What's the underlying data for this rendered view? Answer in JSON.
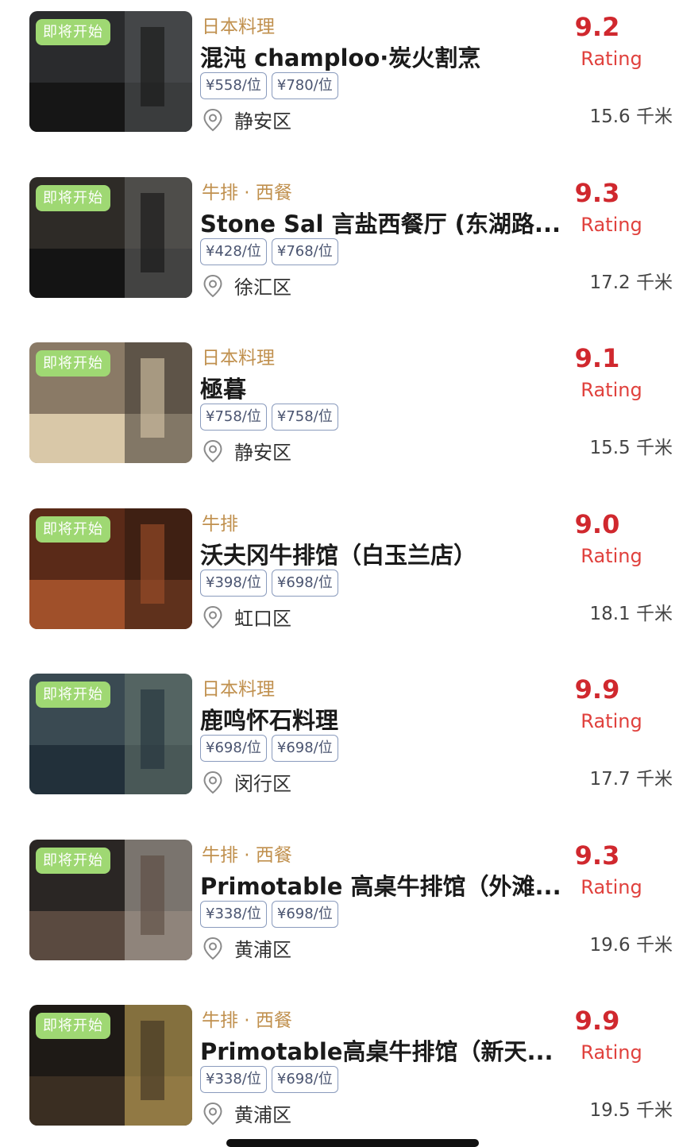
{
  "restaurants": [
    {
      "badge": "即将开始",
      "cuisine": "日本料理",
      "name": "混沌 champloo·炭火割烹",
      "prices": [
        "¥558/位",
        "¥780/位"
      ],
      "district": "静安区",
      "score": "9.2",
      "rating_label": "Rating",
      "distance": "15.6 千米",
      "thumb_colors": [
        "#2a2b2d",
        "#161616",
        "#5a5c5e"
      ]
    },
    {
      "badge": "即将开始",
      "cuisine": "牛排 · 西餐",
      "name": "Stone Sal 言盐西餐厅 (东湖路...",
      "prices": [
        "¥428/位",
        "¥768/位"
      ],
      "district": "徐汇区",
      "score": "9.3",
      "rating_label": "Rating",
      "distance": "17.2 千米",
      "thumb_colors": [
        "#2e2b27",
        "#141414",
        "#6a6a68"
      ]
    },
    {
      "badge": "即将开始",
      "cuisine": "日本料理",
      "name": "極暮",
      "prices": [
        "¥758/位",
        "¥758/位"
      ],
      "district": "静安区",
      "score": "9.1",
      "rating_label": "Rating",
      "distance": "15.5 千米",
      "thumb_colors": [
        "#8a7a66",
        "#d9c8a8",
        "#3a3430"
      ]
    },
    {
      "badge": "即将开始",
      "cuisine": "牛排",
      "name": "沃夫冈牛排馆（白玉兰店）",
      "prices": [
        "¥398/位",
        "¥698/位"
      ],
      "district": "虹口区",
      "score": "9.0",
      "rating_label": "Rating",
      "distance": "18.1 千米",
      "thumb_colors": [
        "#5a2a18",
        "#a0502a",
        "#2a1810"
      ]
    },
    {
      "badge": "即将开始",
      "cuisine": "日本料理",
      "name": "鹿鸣怀石料理",
      "prices": [
        "¥698/位",
        "¥698/位"
      ],
      "district": "闵行区",
      "score": "9.9",
      "rating_label": "Rating",
      "distance": "17.7 千米",
      "thumb_colors": [
        "#3a4a52",
        "#22303a",
        "#6a7a70"
      ]
    },
    {
      "badge": "即将开始",
      "cuisine": "牛排 · 西餐",
      "name": "Primotable 高桌牛排馆（外滩...",
      "prices": [
        "¥338/位",
        "¥698/位"
      ],
      "district": "黄浦区",
      "score": "9.3",
      "rating_label": "Rating",
      "distance": "19.6 千米",
      "thumb_colors": [
        "#2a2624",
        "#5a4a40",
        "#bcb4ac"
      ]
    },
    {
      "badge": "即将开始",
      "cuisine": "牛排 · 西餐",
      "name": "Primotable高桌牛排馆（新天...",
      "prices": [
        "¥338/位",
        "¥698/位"
      ],
      "district": "黄浦区",
      "score": "9.9",
      "rating_label": "Rating",
      "distance": "19.5 千米",
      "thumb_colors": [
        "#1e1a16",
        "#3a2e22",
        "#d8b860"
      ]
    }
  ],
  "colors": {
    "badge": "#9fd873",
    "cuisine": "#c0904e",
    "score": "#d0282e",
    "price_border": "#8a9bbd"
  },
  "icons": {
    "location": "location-pin-icon"
  }
}
